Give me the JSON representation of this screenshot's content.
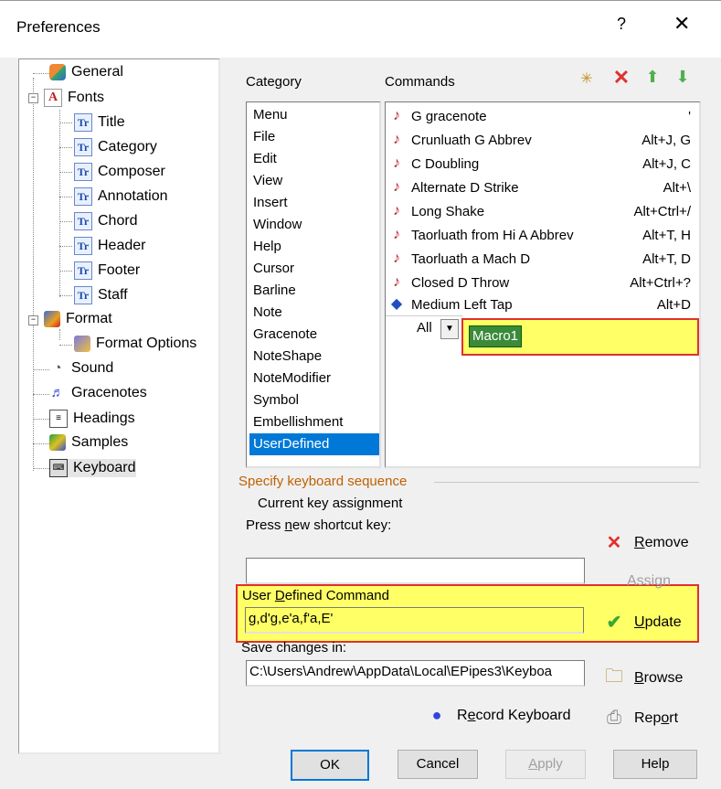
{
  "window": {
    "title": "Preferences",
    "help": "?",
    "close": "✕"
  },
  "tree": {
    "items": [
      {
        "label": "General"
      },
      {
        "label": "Fonts"
      },
      {
        "label": "Title"
      },
      {
        "label": "Category"
      },
      {
        "label": "Composer"
      },
      {
        "label": "Annotation"
      },
      {
        "label": "Chord"
      },
      {
        "label": "Header"
      },
      {
        "label": "Footer"
      },
      {
        "label": "Staff"
      },
      {
        "label": "Format"
      },
      {
        "label": "Format Options"
      },
      {
        "label": "Sound"
      },
      {
        "label": "Gracenotes"
      },
      {
        "label": "Headings"
      },
      {
        "label": "Samples"
      },
      {
        "label": "Keyboard"
      }
    ]
  },
  "category": {
    "label": "Category",
    "items": [
      "Menu",
      "File",
      "Edit",
      "View",
      "Insert",
      "Window",
      "Help",
      "Cursor",
      "Barline",
      "Note",
      "Gracenote",
      "NoteShape",
      "NoteModifier",
      "Symbol",
      "Embellishment",
      "UserDefined"
    ],
    "selected": "UserDefined"
  },
  "commands": {
    "label": "Commands",
    "rows": [
      {
        "name": "G gracenote",
        "key": "'"
      },
      {
        "name": "Crunluath G Abbrev",
        "key": "Alt+J, G"
      },
      {
        "name": "C Doubling",
        "key": "Alt+J, C"
      },
      {
        "name": "Alternate D Strike",
        "key": "Alt+\\"
      },
      {
        "name": "Long Shake",
        "key": "Alt+Ctrl+/"
      },
      {
        "name": "Taorluath from Hi A Abbrev",
        "key": "Alt+T, H"
      },
      {
        "name": "Taorluath a Mach D",
        "key": "Alt+T, D"
      },
      {
        "name": "Closed D Throw",
        "key": "Alt+Ctrl+?"
      },
      {
        "name": "Medium Left Tap",
        "key": "Alt+D"
      }
    ],
    "filter": "All",
    "macro_name": "Macro1"
  },
  "sequence": {
    "group_label": "Specify keyboard sequence",
    "current_label": "Current key assignment",
    "press_label_pre": "Press ",
    "press_label_u": "n",
    "press_label_post": "ew shortcut key:",
    "shortcut_value": "",
    "udc_label_pre": "User ",
    "udc_label_u": "D",
    "udc_label_post": "efined Command",
    "udc_value": "g,d'g,e'a,f'a,E'",
    "save_label": "Save changes in:",
    "save_value": "C:\\Users\\Andrew\\AppData\\Local\\EPipes3\\Keyboa"
  },
  "side_buttons": {
    "remove_u": "R",
    "remove_rest": "emove",
    "assign": "Assign",
    "update_u": "U",
    "update_rest": "pdate",
    "browse_u": "B",
    "browse_rest": "rowse",
    "record_pre": "R",
    "record_u": "e",
    "record_rest": "cord Keyboard",
    "report_pre": "Rep",
    "report_u": "o",
    "report_rest": "rt"
  },
  "footer": {
    "ok": "OK",
    "cancel": "Cancel",
    "apply_u": "A",
    "apply_rest": "pply",
    "help": "Help"
  },
  "colors": {
    "selection": "#0078d7",
    "highlight": "#ffff66",
    "highlight_border": "#e03030"
  }
}
